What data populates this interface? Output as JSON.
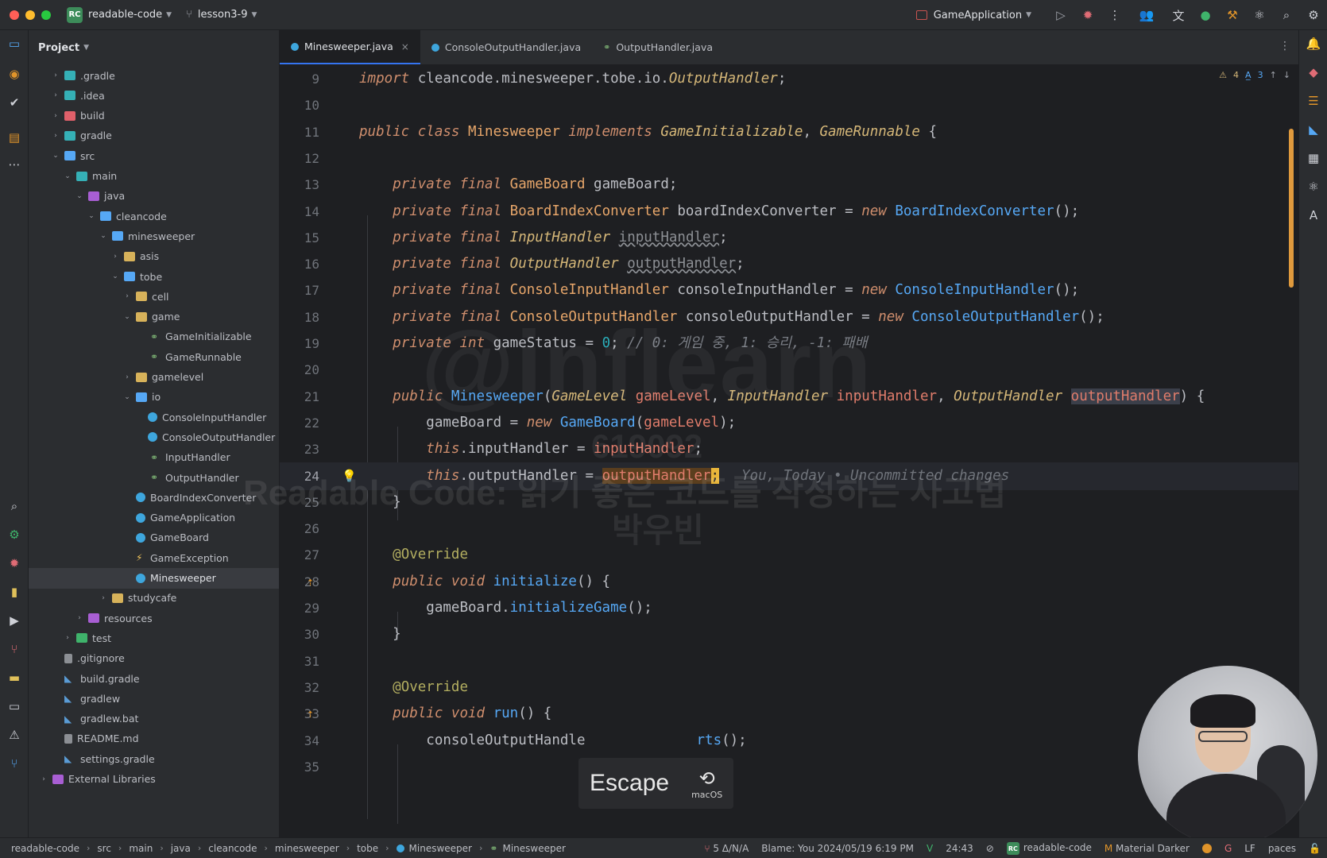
{
  "titlebar": {
    "project_badge": "RC",
    "project_name": "readable-code",
    "branch": "lesson3-9",
    "run_config": "GameApplication"
  },
  "project_panel": {
    "title": "Project",
    "tree": [
      {
        "label": ".gradle",
        "depth": 1,
        "arrow": "›",
        "icon": "folder-teal"
      },
      {
        "label": ".idea",
        "depth": 1,
        "arrow": "›",
        "icon": "folder-teal"
      },
      {
        "label": "build",
        "depth": 1,
        "arrow": "›",
        "icon": "folder-red"
      },
      {
        "label": "gradle",
        "depth": 1,
        "arrow": "›",
        "icon": "folder-teal"
      },
      {
        "label": "src",
        "depth": 1,
        "arrow": "⌄",
        "icon": "folder-blue"
      },
      {
        "label": "main",
        "depth": 2,
        "arrow": "⌄",
        "icon": "folder-teal"
      },
      {
        "label": "java",
        "depth": 3,
        "arrow": "⌄",
        "icon": "folder-purple"
      },
      {
        "label": "cleancode",
        "depth": 4,
        "arrow": "⌄",
        "icon": "folder-blue"
      },
      {
        "label": "minesweeper",
        "depth": 5,
        "arrow": "⌄",
        "icon": "folder-blue"
      },
      {
        "label": "asis",
        "depth": 6,
        "arrow": "›",
        "icon": "folder"
      },
      {
        "label": "tobe",
        "depth": 6,
        "arrow": "⌄",
        "icon": "folder-blue"
      },
      {
        "label": "cell",
        "depth": 7,
        "arrow": "›",
        "icon": "folder"
      },
      {
        "label": "game",
        "depth": 7,
        "arrow": "⌄",
        "icon": "folder"
      },
      {
        "label": "GameInitializable",
        "depth": 8,
        "arrow": "",
        "icon": "iface"
      },
      {
        "label": "GameRunnable",
        "depth": 8,
        "arrow": "",
        "icon": "iface"
      },
      {
        "label": "gamelevel",
        "depth": 7,
        "arrow": "›",
        "icon": "folder"
      },
      {
        "label": "io",
        "depth": 7,
        "arrow": "⌄",
        "icon": "folder-blue"
      },
      {
        "label": "ConsoleInputHandler",
        "depth": 8,
        "arrow": "",
        "icon": "class"
      },
      {
        "label": "ConsoleOutputHandler",
        "depth": 8,
        "arrow": "",
        "icon": "class"
      },
      {
        "label": "InputHandler",
        "depth": 8,
        "arrow": "",
        "icon": "iface"
      },
      {
        "label": "OutputHandler",
        "depth": 8,
        "arrow": "",
        "icon": "iface"
      },
      {
        "label": "BoardIndexConverter",
        "depth": 7,
        "arrow": "",
        "icon": "class"
      },
      {
        "label": "GameApplication",
        "depth": 7,
        "arrow": "",
        "icon": "class"
      },
      {
        "label": "GameBoard",
        "depth": 7,
        "arrow": "",
        "icon": "class"
      },
      {
        "label": "GameException",
        "depth": 7,
        "arrow": "",
        "icon": "exc"
      },
      {
        "label": "Minesweeper",
        "depth": 7,
        "arrow": "",
        "icon": "class",
        "selected": true
      },
      {
        "label": "studycafe",
        "depth": 5,
        "arrow": "›",
        "icon": "folder"
      },
      {
        "label": "resources",
        "depth": 3,
        "arrow": "›",
        "icon": "folder-purple"
      },
      {
        "label": "test",
        "depth": 2,
        "arrow": "›",
        "icon": "folder-green"
      },
      {
        "label": ".gitignore",
        "depth": 1,
        "arrow": "",
        "icon": "file"
      },
      {
        "label": "build.gradle",
        "depth": 1,
        "arrow": "",
        "icon": "gradle"
      },
      {
        "label": "gradlew",
        "depth": 1,
        "arrow": "",
        "icon": "gradle"
      },
      {
        "label": "gradlew.bat",
        "depth": 1,
        "arrow": "",
        "icon": "gradle"
      },
      {
        "label": "README.md",
        "depth": 1,
        "arrow": "",
        "icon": "file"
      },
      {
        "label": "settings.gradle",
        "depth": 1,
        "arrow": "",
        "icon": "gradle"
      },
      {
        "label": "External Libraries",
        "depth": 0,
        "arrow": "›",
        "icon": "folder-purple"
      }
    ]
  },
  "tabs": [
    {
      "label": "Minesweeper.java",
      "active": true,
      "icon": "class"
    },
    {
      "label": "ConsoleOutputHandler.java",
      "active": false,
      "icon": "class"
    },
    {
      "label": "OutputHandler.java",
      "active": false,
      "icon": "iface"
    }
  ],
  "editor": {
    "inspections": {
      "warnings": "4",
      "typos": "3"
    },
    "lines": [
      {
        "n": "9",
        "gutter": "green"
      },
      {
        "n": "10"
      },
      {
        "n": "11"
      },
      {
        "n": "12"
      },
      {
        "n": "13"
      },
      {
        "n": "14"
      },
      {
        "n": "15",
        "gutter": "green"
      },
      {
        "n": "16",
        "gutter": "green"
      },
      {
        "n": "17"
      },
      {
        "n": "18"
      },
      {
        "n": "19"
      },
      {
        "n": "20"
      },
      {
        "n": "21",
        "gutter": "orange"
      },
      {
        "n": "22"
      },
      {
        "n": "23",
        "gutter": "green"
      },
      {
        "n": "24",
        "gutter": "green",
        "current": true
      },
      {
        "n": "25"
      },
      {
        "n": "26"
      },
      {
        "n": "27"
      },
      {
        "n": "28"
      },
      {
        "n": "29"
      },
      {
        "n": "30"
      },
      {
        "n": "31"
      },
      {
        "n": "32"
      },
      {
        "n": "33"
      },
      {
        "n": "34"
      },
      {
        "n": "35"
      }
    ],
    "tokens": {
      "l9": [
        "import",
        " cleancode.minesweeper.tobe.io.",
        "OutputHandler",
        ";"
      ],
      "l11": [
        "public class ",
        "Minesweeper",
        " implements ",
        "GameInitializable",
        ", ",
        "GameRunnable",
        " {"
      ],
      "l13": [
        "private final ",
        "GameBoard",
        " gameBoard;"
      ],
      "l14": [
        "private final ",
        "BoardIndexConverter",
        " boardIndexConverter = ",
        "new ",
        "BoardIndexConverter",
        "();"
      ],
      "l15": [
        "private final ",
        "InputHandler",
        " ",
        "inputHandler",
        ";"
      ],
      "l16": [
        "private final ",
        "OutputHandler",
        " ",
        "outputHandler",
        ";"
      ],
      "l17": [
        "private final ",
        "ConsoleInputHandler",
        " consoleInputHandler = ",
        "new ",
        "ConsoleInputHandler",
        "();"
      ],
      "l18": [
        "private final ",
        "ConsoleOutputHandler",
        " consoleOutputHandler = ",
        "new ",
        "ConsoleOutputHandler",
        "();"
      ],
      "l19": [
        "private ",
        "int",
        " gameStatus = ",
        "0",
        "; ",
        "// 0: 게임 중, 1: 승리, -1: 패배"
      ],
      "l21": [
        "public ",
        "Minesweeper",
        "(",
        "GameLevel",
        " ",
        "gameLevel",
        ", ",
        "InputHandler",
        " ",
        "inputHandler",
        ", ",
        "OutputHandler",
        " ",
        "outputHandler",
        ") {"
      ],
      "l22": [
        "gameBoard = ",
        "new ",
        "GameBoard",
        "(",
        "gameLevel",
        ");"
      ],
      "l23": [
        "this",
        ".inputHandler = ",
        "inputHandler",
        ";"
      ],
      "l24": [
        "this",
        ".outputHandler = ",
        "outputHandler",
        ";",
        "You, Today • Uncommitted changes"
      ],
      "l25": [
        "}"
      ],
      "l27": [
        "@Override"
      ],
      "l28": [
        "public void ",
        "initialize",
        "() {"
      ],
      "l29": [
        "gameBoard.",
        "initializeGame",
        "();"
      ],
      "l30": [
        "}"
      ],
      "l32": [
        "@Override"
      ],
      "l33": [
        "public void ",
        "run",
        "() {"
      ],
      "l34": [
        "consoleOutputHandle",
        "r",
        "ts",
        "();"
      ]
    }
  },
  "watermark": {
    "id": "619092",
    "title": "Readable Code: 읽기 좋은 코드를 작성하는 사고법",
    "name": "박우빈"
  },
  "key_overlay": {
    "key": "Escape",
    "os_label": "macOS"
  },
  "statusbar": {
    "crumbs": [
      "readable-code",
      "src",
      "main",
      "java",
      "cleancode",
      "minesweeper",
      "tobe",
      "Minesweeper",
      "Minesweeper"
    ],
    "vcs": "5 Δ/N/A",
    "blame": "Blame: You 2024/05/19 6:19 PM",
    "position": "24:43",
    "project_badge": "RC",
    "project": "readable-code",
    "theme": "Material Darker",
    "lf": "LF",
    "spaces": "paces"
  }
}
